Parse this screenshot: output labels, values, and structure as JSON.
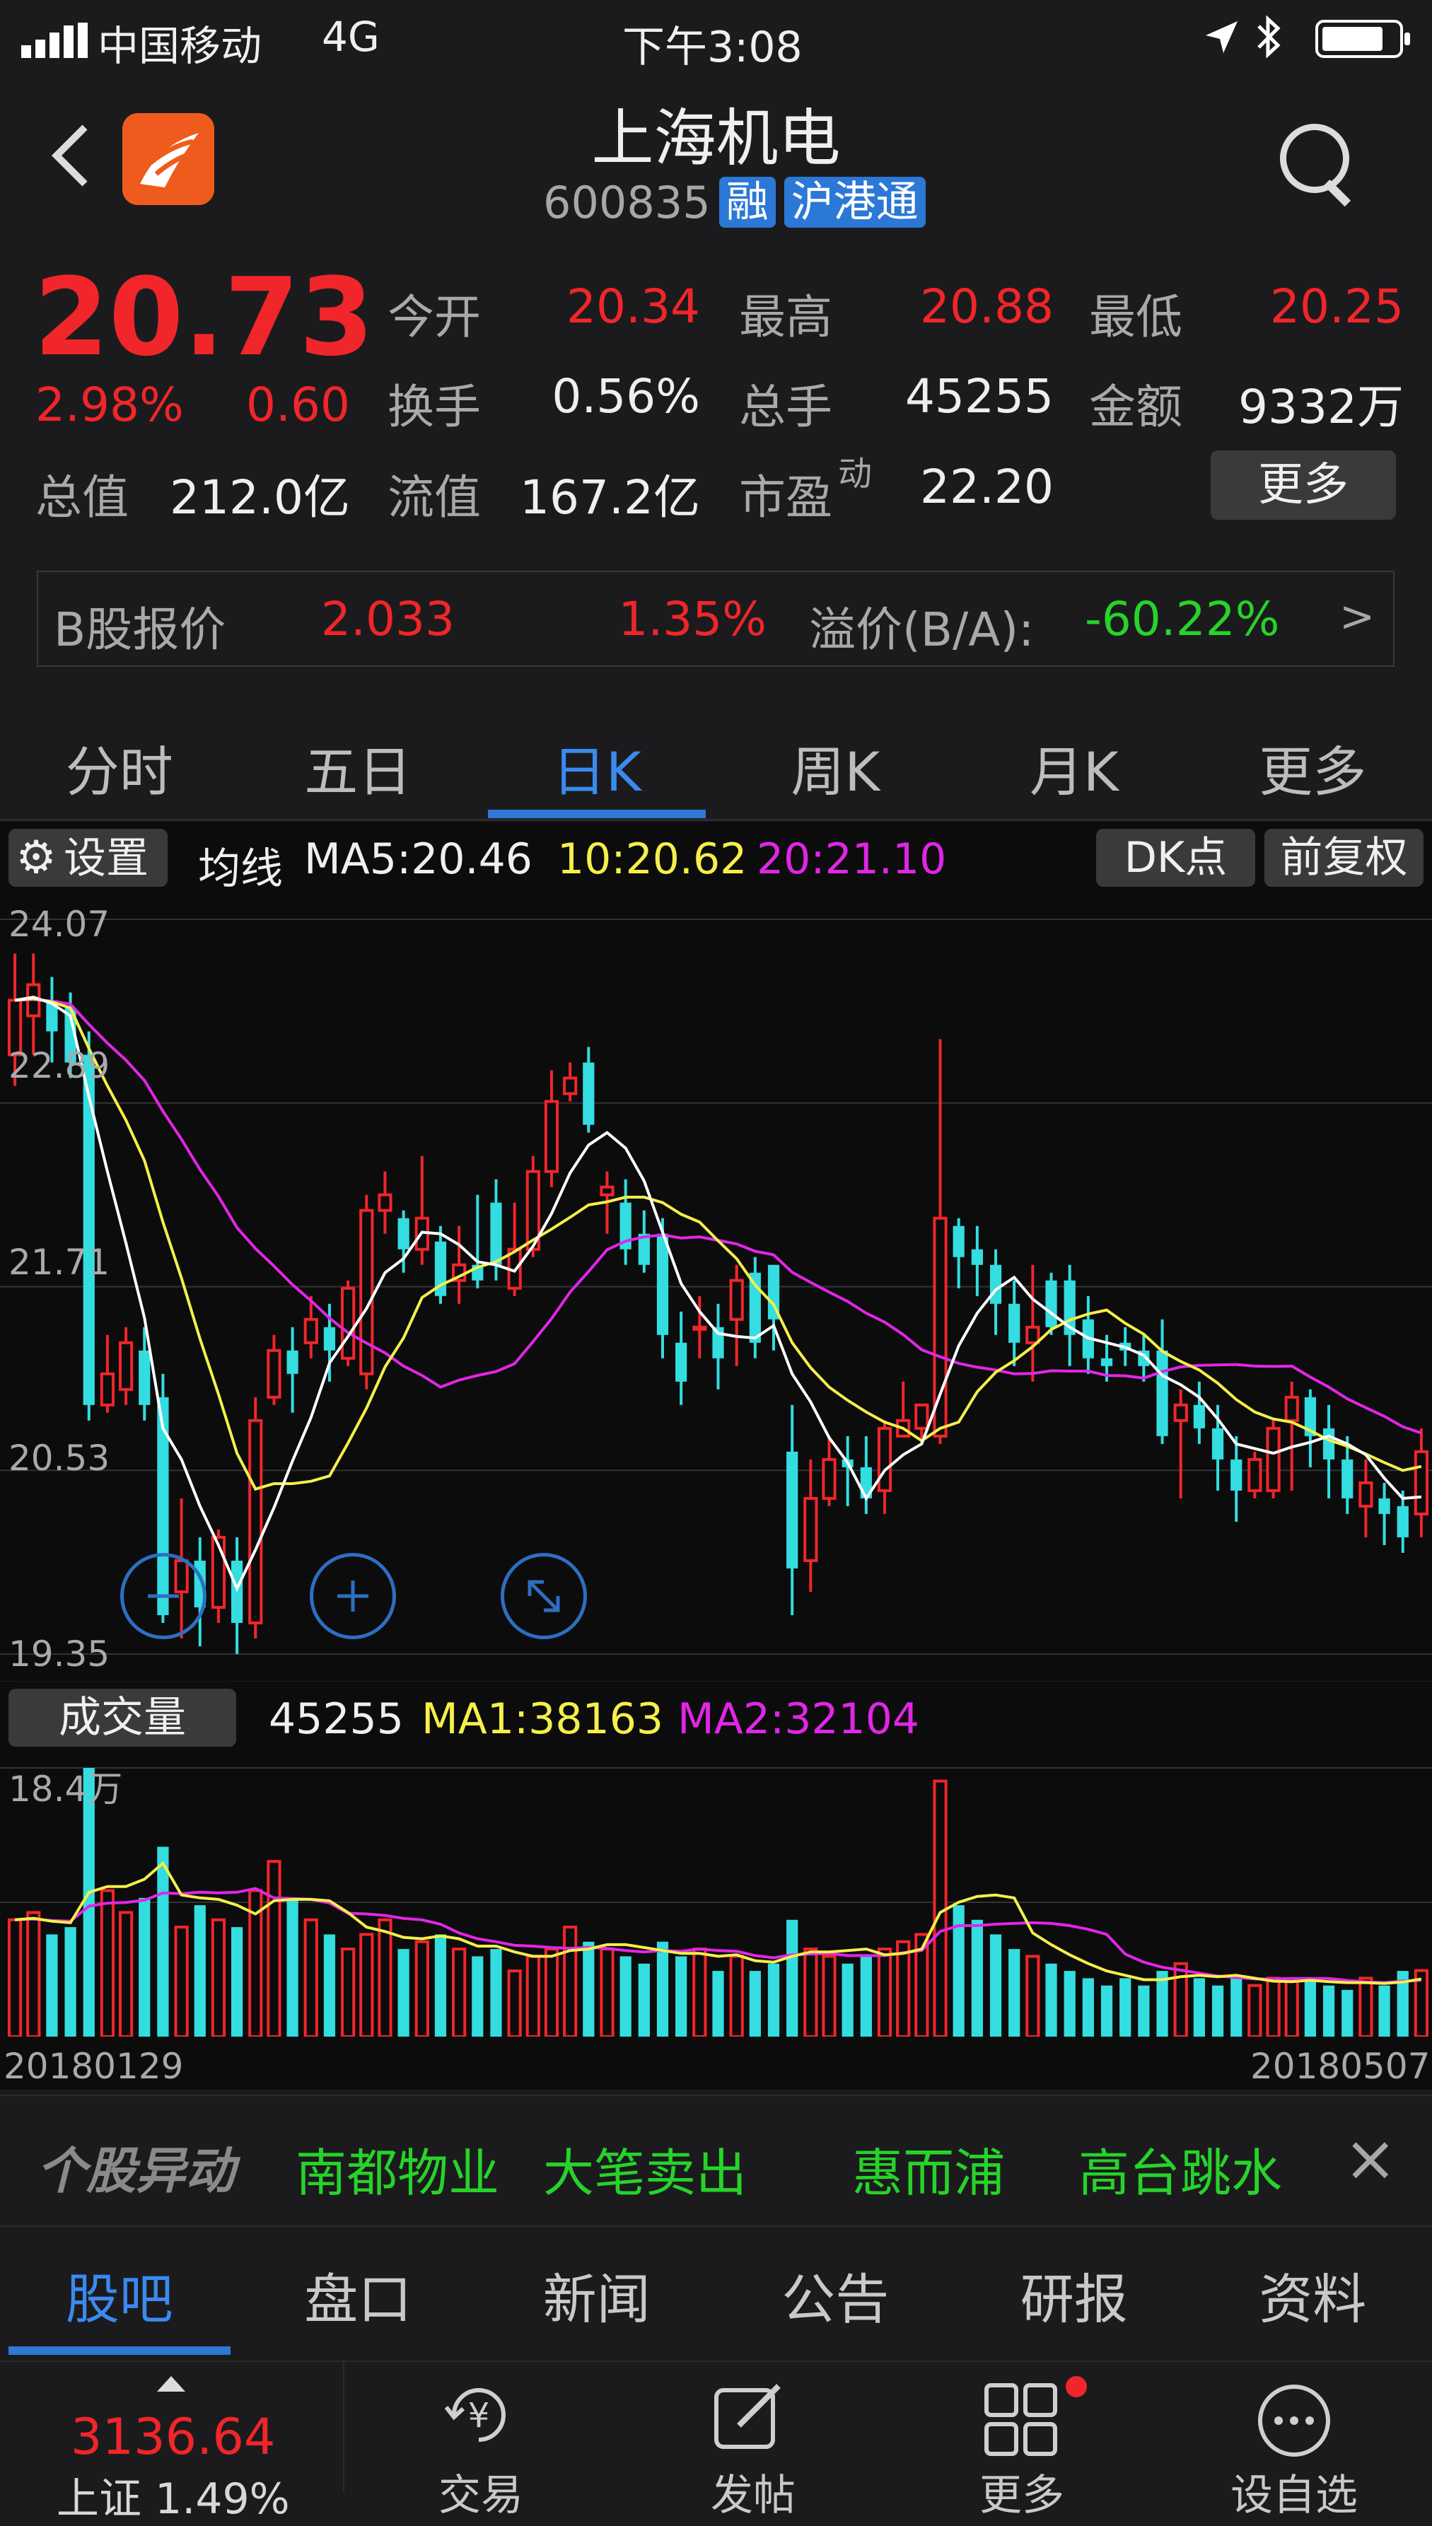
{
  "status_bar": {
    "carrier": "中国移动",
    "network": "4G",
    "time": "下午3:08"
  },
  "header": {
    "title": "上海机电",
    "code": "600835",
    "tag_margin": "融",
    "tag_connect": "沪港通"
  },
  "quote": {
    "price": "20.73",
    "change_pct": "2.98%",
    "change": "0.60",
    "open_label": "今开",
    "open": "20.34",
    "high_label": "最高",
    "high": "20.88",
    "low_label": "最低",
    "low": "20.25",
    "turnover_label": "换手",
    "turnover": "0.56%",
    "volume_label": "总手",
    "volume": "45255",
    "amount_label": "金额",
    "amount": "9332万",
    "mktcap_label": "总值",
    "mktcap": "212.0亿",
    "float_label": "流值",
    "float": "167.2亿",
    "pe_label": "市盈",
    "pe_sup": "动",
    "pe": "22.20",
    "more_button": "更多"
  },
  "bshare": {
    "label": "B股报价",
    "price": "2.033",
    "pct": "1.35%",
    "premium_label": "溢价(B/A):",
    "premium": "-60.22%",
    "arrow": ">"
  },
  "period_tabs": [
    "分时",
    "五日",
    "日K",
    "周K",
    "月K",
    "更多"
  ],
  "active_period": 2,
  "ma_bar": {
    "settings": "设置",
    "label": "均线",
    "ma5": "MA5:20.46",
    "ma10": "10:20.62",
    "ma20": "20:21.10",
    "dk_button": "DK点",
    "adjust_button": "前复权"
  },
  "volume_bar": {
    "label": "成交量",
    "value": "45255",
    "ma1": "MA1:38163",
    "ma2": "MA2:32104"
  },
  "chart_data": {
    "type": "candlestick",
    "price_ticks": [
      "24.07",
      "22.89",
      "21.71",
      "20.53",
      "19.35"
    ],
    "ylim": [
      19.35,
      24.07
    ],
    "volume_max_label": "18.4万",
    "volume_max": 184000,
    "x_start_label": "20180129",
    "x_end_label": "20180507",
    "colors": {
      "up": "#f0262a",
      "down": "#33dde0",
      "ma5": "#ffffff",
      "ma10": "#f5ef4a",
      "ma20": "#e126e6"
    },
    "candles": [
      [
        23.2,
        23.55,
        23.85,
        23.0
      ],
      [
        23.45,
        23.65,
        23.85,
        23.2
      ],
      [
        23.55,
        23.35,
        23.7,
        23.15
      ],
      [
        23.5,
        23.15,
        23.6,
        23.05
      ],
      [
        23.2,
        20.95,
        23.35,
        20.85
      ],
      [
        20.95,
        21.15,
        21.4,
        20.9
      ],
      [
        21.05,
        21.35,
        21.45,
        20.95
      ],
      [
        21.3,
        20.95,
        21.45,
        20.85
      ],
      [
        21.0,
        19.6,
        21.15,
        19.55
      ],
      [
        19.75,
        19.95,
        20.35,
        19.45
      ],
      [
        19.95,
        19.65,
        20.1,
        19.4
      ],
      [
        19.65,
        20.1,
        20.15,
        19.55
      ],
      [
        19.95,
        19.55,
        20.1,
        19.35
      ],
      [
        19.55,
        20.85,
        21.0,
        19.45
      ],
      [
        21.0,
        21.3,
        21.4,
        20.95
      ],
      [
        21.3,
        21.15,
        21.45,
        20.9
      ],
      [
        21.35,
        21.5,
        21.65,
        21.25
      ],
      [
        21.45,
        21.3,
        21.6,
        21.1
      ],
      [
        21.25,
        21.7,
        21.75,
        21.2
      ],
      [
        21.15,
        22.2,
        22.3,
        21.05
      ],
      [
        22.2,
        22.3,
        22.45,
        22.05
      ],
      [
        22.15,
        21.95,
        22.2,
        21.8
      ],
      [
        21.95,
        22.15,
        22.55,
        21.85
      ],
      [
        22.0,
        21.65,
        22.1,
        21.6
      ],
      [
        21.75,
        21.85,
        22.1,
        21.6
      ],
      [
        21.85,
        21.75,
        22.3,
        21.7
      ],
      [
        22.25,
        21.85,
        22.4,
        21.75
      ],
      [
        21.7,
        21.95,
        22.25,
        21.65
      ],
      [
        21.95,
        22.45,
        22.55,
        21.9
      ],
      [
        22.45,
        22.9,
        23.1,
        22.35
      ],
      [
        22.95,
        23.05,
        23.15,
        22.9
      ],
      [
        23.15,
        22.75,
        23.25,
        22.7
      ],
      [
        22.3,
        22.35,
        22.45,
        22.05
      ],
      [
        22.25,
        21.95,
        22.4,
        21.85
      ],
      [
        22.05,
        21.85,
        22.2,
        21.8
      ],
      [
        22.05,
        21.4,
        22.15,
        21.25
      ],
      [
        21.35,
        21.1,
        21.55,
        20.95
      ],
      [
        21.45,
        21.45,
        21.65,
        21.25
      ],
      [
        21.45,
        21.25,
        21.6,
        21.05
      ],
      [
        21.5,
        21.75,
        21.85,
        21.2
      ],
      [
        21.8,
        21.35,
        21.9,
        21.25
      ],
      [
        21.85,
        21.5,
        21.85,
        21.3
      ],
      [
        20.65,
        19.9,
        20.95,
        19.6
      ],
      [
        19.95,
        20.35,
        20.6,
        19.75
      ],
      [
        20.35,
        20.6,
        20.75,
        20.3
      ],
      [
        20.6,
        20.55,
        20.75,
        20.3
      ],
      [
        20.55,
        20.35,
        20.75,
        20.25
      ],
      [
        20.4,
        20.8,
        20.85,
        20.25
      ],
      [
        20.75,
        20.85,
        21.1,
        20.75
      ],
      [
        20.8,
        20.95,
        20.95,
        20.7
      ],
      [
        20.75,
        22.15,
        23.3,
        20.7
      ],
      [
        22.1,
        21.9,
        22.15,
        21.7
      ],
      [
        21.95,
        21.85,
        22.1,
        21.65
      ],
      [
        21.85,
        21.6,
        21.95,
        21.4
      ],
      [
        21.6,
        21.35,
        21.75,
        21.2
      ],
      [
        21.35,
        21.45,
        21.85,
        21.1
      ],
      [
        21.75,
        21.45,
        21.8,
        21.4
      ],
      [
        21.75,
        21.4,
        21.85,
        21.2
      ],
      [
        21.5,
        21.25,
        21.65,
        21.15
      ],
      [
        21.25,
        21.2,
        21.4,
        21.1
      ],
      [
        21.35,
        21.3,
        21.45,
        21.2
      ],
      [
        21.3,
        21.2,
        21.4,
        21.1
      ],
      [
        21.3,
        20.75,
        21.5,
        20.7
      ],
      [
        20.85,
        20.95,
        21.05,
        20.35
      ],
      [
        20.95,
        20.8,
        21.1,
        20.7
      ],
      [
        20.8,
        20.6,
        20.95,
        20.4
      ],
      [
        20.6,
        20.4,
        20.75,
        20.2
      ],
      [
        20.4,
        20.6,
        20.65,
        20.35
      ],
      [
        20.4,
        20.8,
        20.85,
        20.35
      ],
      [
        20.85,
        21.0,
        21.1,
        20.4
      ],
      [
        21.0,
        20.75,
        21.05,
        20.55
      ],
      [
        20.8,
        20.6,
        20.95,
        20.35
      ],
      [
        20.6,
        20.35,
        20.75,
        20.25
      ],
      [
        20.3,
        20.45,
        20.6,
        20.1
      ],
      [
        20.35,
        20.25,
        20.45,
        20.05
      ],
      [
        20.3,
        20.1,
        20.4,
        20.0
      ],
      [
        20.25,
        20.65,
        20.8,
        20.1
      ]
    ],
    "volumes": [
      80000,
      85000,
      70000,
      75000,
      184000,
      100000,
      85000,
      95000,
      130000,
      75000,
      90000,
      80000,
      75000,
      100000,
      120000,
      95000,
      80000,
      70000,
      60000,
      70000,
      80000,
      60000,
      65000,
      70000,
      60000,
      55000,
      60000,
      45000,
      55000,
      60000,
      75000,
      65000,
      60000,
      55000,
      50000,
      65000,
      55000,
      60000,
      45000,
      55000,
      45000,
      50000,
      80000,
      60000,
      55000,
      50000,
      55000,
      60000,
      65000,
      70000,
      175000,
      90000,
      80000,
      70000,
      60000,
      55000,
      50000,
      45000,
      40000,
      35000,
      40000,
      35000,
      45000,
      50000,
      40000,
      35000,
      40000,
      35000,
      40000,
      38000,
      40000,
      35000,
      32000,
      40000,
      35000,
      45000,
      45255
    ]
  },
  "alert_bar": {
    "title": "个股异动",
    "items": [
      "南都物业",
      "大笔卖出",
      "惠而浦",
      "高台跳水"
    ],
    "close": "×"
  },
  "bottom_tabs": [
    "股吧",
    "盘口",
    "新闻",
    "公告",
    "研报",
    "资料"
  ],
  "active_bottom_tab": 0,
  "nav": {
    "index_value": "3136.64",
    "index_partial": "上证 1.49%",
    "items": [
      "交易",
      "发帖",
      "更多",
      "设自选"
    ]
  }
}
